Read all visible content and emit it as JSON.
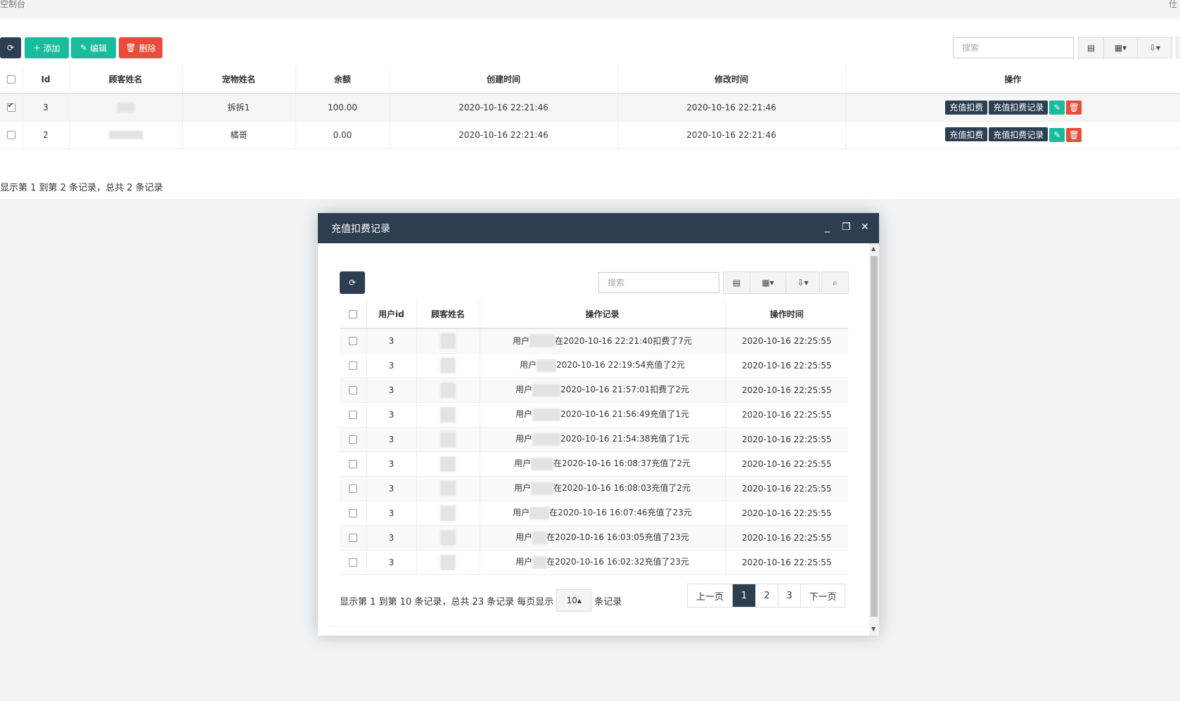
{
  "topbar": {
    "crumb": "空制台",
    "corner": "仕"
  },
  "toolbar": {
    "refresh_icon": "refresh-icon",
    "add_label": "添加",
    "edit_label": "编辑",
    "delete_label": "删除",
    "search_placeholder": "搜索"
  },
  "main_table": {
    "headers": [
      "Id",
      "顾客姓名",
      "宠物姓名",
      "余额",
      "创建时间",
      "修改时间",
      "操作"
    ],
    "rows": [
      {
        "checked": true,
        "id": "3",
        "pet": "拆拆1",
        "balance": "100.00",
        "created": "2020-10-16 22:21:46",
        "modified": "2020-10-16 22:21:46"
      },
      {
        "checked": false,
        "id": "2",
        "pet": "橘哥",
        "balance": "0.00",
        "created": "2020-10-16 22:21:46",
        "modified": "2020-10-16 22:21:46"
      }
    ],
    "action_recharge": "充值扣费",
    "action_records": "充值扣费记录"
  },
  "main_info": "显示第 1 到第 2 条记录，总共 2 条记录",
  "modal": {
    "title": "充值扣费记录",
    "search_placeholder": "搜索",
    "headers": [
      "用户id",
      "顾客姓名",
      "操作记录",
      "操作时间"
    ],
    "rows": [
      {
        "uid": "3",
        "record_prefix": "用户",
        "record_suffix": "在2020-10-16 22:21:40扣费了7元",
        "time": "2020-10-16 22:25:55"
      },
      {
        "uid": "3",
        "record_prefix": "用户",
        "record_suffix": "2020-10-16 22:19:54充值了2元",
        "time": "2020-10-16 22:25:55"
      },
      {
        "uid": "3",
        "record_prefix": "用户",
        "record_suffix": "2020-10-16 21:57:01扣费了2元",
        "time": "2020-10-16 22:25:55"
      },
      {
        "uid": "3",
        "record_prefix": "用户",
        "record_suffix": "2020-10-16 21:56:49充值了1元",
        "time": "2020-10-16 22:25:55"
      },
      {
        "uid": "3",
        "record_prefix": "用户",
        "record_suffix": "2020-10-16 21:54:38充值了1元",
        "time": "2020-10-16 22:25:55"
      },
      {
        "uid": "3",
        "record_prefix": "用户",
        "record_suffix": "在2020-10-16 16:08:37充值了2元",
        "time": "2020-10-16 22:25:55"
      },
      {
        "uid": "3",
        "record_prefix": "用户",
        "record_suffix": "在2020-10-16 16:08:03充值了2元",
        "time": "2020-10-16 22:25:55"
      },
      {
        "uid": "3",
        "record_prefix": "用户",
        "record_suffix": "在2020-10-16 16:07:46充值了23元",
        "time": "2020-10-16 22:25:55"
      },
      {
        "uid": "3",
        "record_prefix": "用户",
        "record_suffix": "在2020-10-16 16:03:05充值了23元",
        "time": "2020-10-16 22:25:55"
      },
      {
        "uid": "3",
        "record_prefix": "用户",
        "record_suffix": "在2020-10-16 16:02:32充值了23元",
        "time": "2020-10-16 22:25:55"
      }
    ],
    "info_prefix": "显示第 1 到第 10 条记录，总共 23 条记录 每页显示",
    "page_size": "10",
    "info_suffix": "条记录",
    "pager": {
      "prev": "上一页",
      "pages": [
        "1",
        "2",
        "3"
      ],
      "active": "1",
      "next": "下一页"
    }
  },
  "colors": {
    "dark": "#2c3e50",
    "green": "#18bc9c",
    "red": "#e74c3c"
  }
}
